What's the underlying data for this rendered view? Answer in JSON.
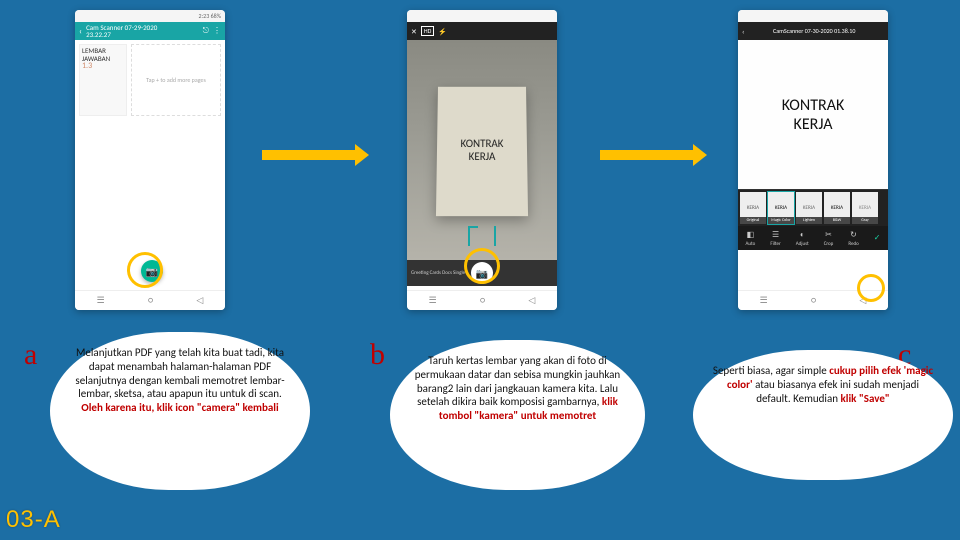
{
  "phone1": {
    "statusbar": "2:23  68%",
    "title": "Cam Scanner 07-29-2020\n23.22.27",
    "thumb_text": "LEMBAR\nJAWABAN",
    "thumb_num": "1.3",
    "addmore": "Tap + to add more pages"
  },
  "phone2": {
    "mode_hd": "HD",
    "paper_l1": "KONTRAK",
    "paper_l2": "KERJA",
    "modes": "Greeting Cards   Docs   Single"
  },
  "phone3": {
    "title": "CamScanner 07-30-2020 01.38.10",
    "img_l1": "KONTRAK",
    "img_l2": "KERJA",
    "filters": [
      "Original",
      "Magic Color",
      "Lighten",
      "B&W",
      "Gray"
    ],
    "tools": [
      "Auto",
      "Filter",
      "Adjust",
      "Crop",
      "Redo"
    ],
    "check": "✓"
  },
  "labels": {
    "a": "a",
    "b": "b",
    "c": "c"
  },
  "bubbles": {
    "a_pre": "Melanjutkan PDF yang telah kita buat tadi, kita dapat menambah halaman-halaman PDF selanjutnya dengan kembali memotret lembar-lembar, sketsa, atau apapun itu untuk di scan. ",
    "a_red": "Oleh karena itu, klik icon \"camera\" kembali",
    "b_pre": "Taruh kertas lembar yang akan di foto di permukaan datar dan sebisa mungkin jauhkan barang2 lain dari jangkauan kamera kita. Lalu setelah dikira baik komposisi gambarnya, ",
    "b_red": "klik tombol \"kamera\" untuk memotret",
    "c_pre": "Seperti biasa, agar simple ",
    "c_red": "cukup pilih efek 'magic color'",
    "c_post": " atau biasanya efek ini sudah menjadi default. Kemudian ",
    "c_red2": "klik \"Save\""
  },
  "page_number": "03-A"
}
